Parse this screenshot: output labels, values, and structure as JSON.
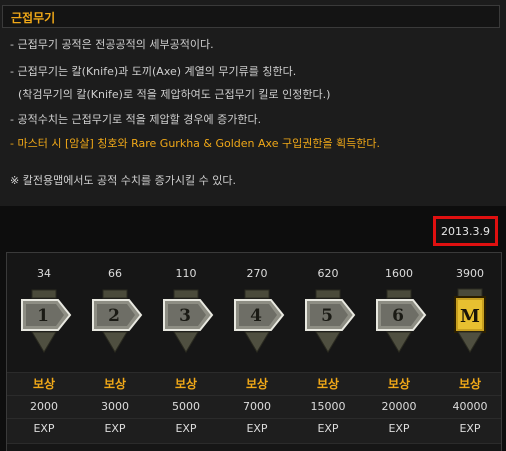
{
  "panel": {
    "title": "근접무기",
    "lines": [
      {
        "text": "- 근접무기 공적은 전공공적의 세부공적이다.",
        "tone": "normal"
      },
      {
        "text": "- 근접무기는 칼(Knife)과 도끼(Axe) 계열의 무기류를 칭한다.",
        "tone": "normal"
      },
      {
        "text": "(착검무기의 칼(Knife)로 적을 제압하여도 근접무기 킬로 인정한다.)",
        "tone": "normal"
      },
      {
        "text": "- 공적수치는 근접무기로 적을 제압할 경우에 증가한다.",
        "tone": "normal"
      },
      {
        "text": "- 마스터 시 [암살] 칭호와 Rare Gurkha & Golden Axe 구입권한을 획득한다.",
        "tone": "orange"
      },
      {
        "text": "※ 칼전용맵에서도 공적 수치를 증가시킬 수 있다.",
        "tone": "normal"
      }
    ]
  },
  "date": "2013.3.9",
  "ranks": [
    {
      "requirement": "34",
      "badge": "1",
      "reward_label": "보상",
      "reward_amount": "2000",
      "reward_unit": "EXP"
    },
    {
      "requirement": "66",
      "badge": "2",
      "reward_label": "보상",
      "reward_amount": "3000",
      "reward_unit": "EXP"
    },
    {
      "requirement": "110",
      "badge": "3",
      "reward_label": "보상",
      "reward_amount": "5000",
      "reward_unit": "EXP"
    },
    {
      "requirement": "270",
      "badge": "4",
      "reward_label": "보상",
      "reward_amount": "7000",
      "reward_unit": "EXP"
    },
    {
      "requirement": "620",
      "badge": "5",
      "reward_label": "보상",
      "reward_amount": "15000",
      "reward_unit": "EXP"
    },
    {
      "requirement": "1600",
      "badge": "6",
      "reward_label": "보상",
      "reward_amount": "20000",
      "reward_unit": "EXP"
    },
    {
      "requirement": "3900",
      "badge": "M",
      "reward_label": "보상",
      "reward_amount": "40000",
      "reward_unit": "EXP"
    }
  ],
  "colors": {
    "accent": "#f0a818",
    "highlight_box": "#e01010",
    "text": "#cfcfcf"
  },
  "icons": {
    "rank_badge": "arrow-rank-badge-icon",
    "master_badge": "master-badge-icon"
  }
}
